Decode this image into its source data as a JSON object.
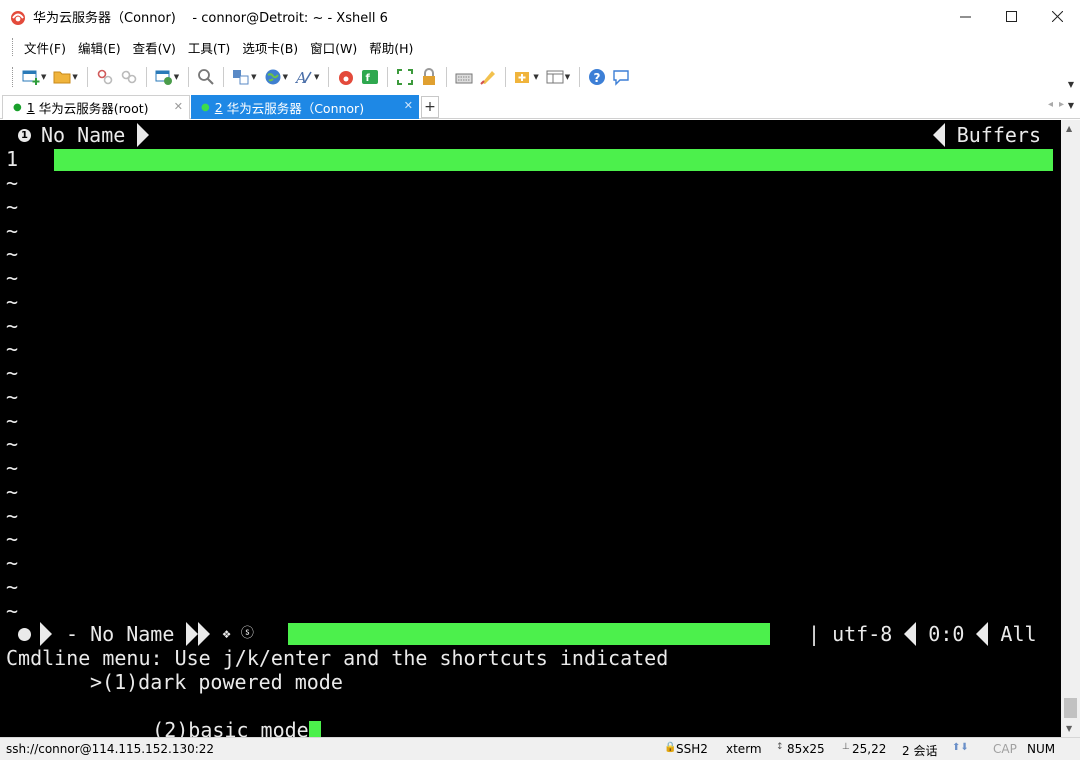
{
  "window": {
    "title": "华为云服务器（Connor)    - connor@Detroit: ~ - Xshell 6",
    "app_icon": "xshell-logo-icon",
    "controls": [
      "minimize-icon",
      "maximize-icon",
      "close-icon"
    ]
  },
  "menu": {
    "items": [
      "文件(F)",
      "编辑(E)",
      "查看(V)",
      "工具(T)",
      "选项卡(B)",
      "窗口(W)",
      "帮助(H)"
    ]
  },
  "toolbar": {
    "buttons": [
      "new-session-icon",
      "open-folder-icon",
      "disconnect-icon",
      "reconnect-icon",
      "properties-icon",
      "find-icon",
      "transfer-icon",
      "globe-icon",
      "font-icon",
      "xshell-icon",
      "xftp-icon",
      "fullscreen-icon",
      "lock-icon",
      "keyboard-icon",
      "highlight-icon",
      "new-tab-icon",
      "layout-icon",
      "help-icon",
      "chat-icon"
    ]
  },
  "tabs": [
    {
      "num": "1",
      "label": "华为云服务器(root)",
      "active": false
    },
    {
      "num": "2",
      "label": "华为云服务器（Connor)",
      "active": true
    }
  ],
  "terminal": {
    "tabline_left": "No Name",
    "tabline_right": "Buffers",
    "line_number": "1",
    "tilde_char": "~",
    "statusline_left": "- No Name",
    "statusline_enc": "| utf-8",
    "statusline_pos": "0:0",
    "statusline_scroll": "All",
    "cmdline_prompt": "Cmdline menu: Use j/k/enter and the shortcuts indicated",
    "menu_option_1": ">(1)dark powered mode",
    "menu_option_2": "(2)basic mode",
    "accent": "#4cf04c"
  },
  "statusbar": {
    "connection": "ssh://connor@114.115.152.130:22",
    "protocol": "SSH2",
    "terminal_type": "xterm",
    "size": "85x25",
    "cursor_pos": "25,22",
    "sessions": "2 会话",
    "caps": "CAP",
    "num": "NUM"
  }
}
